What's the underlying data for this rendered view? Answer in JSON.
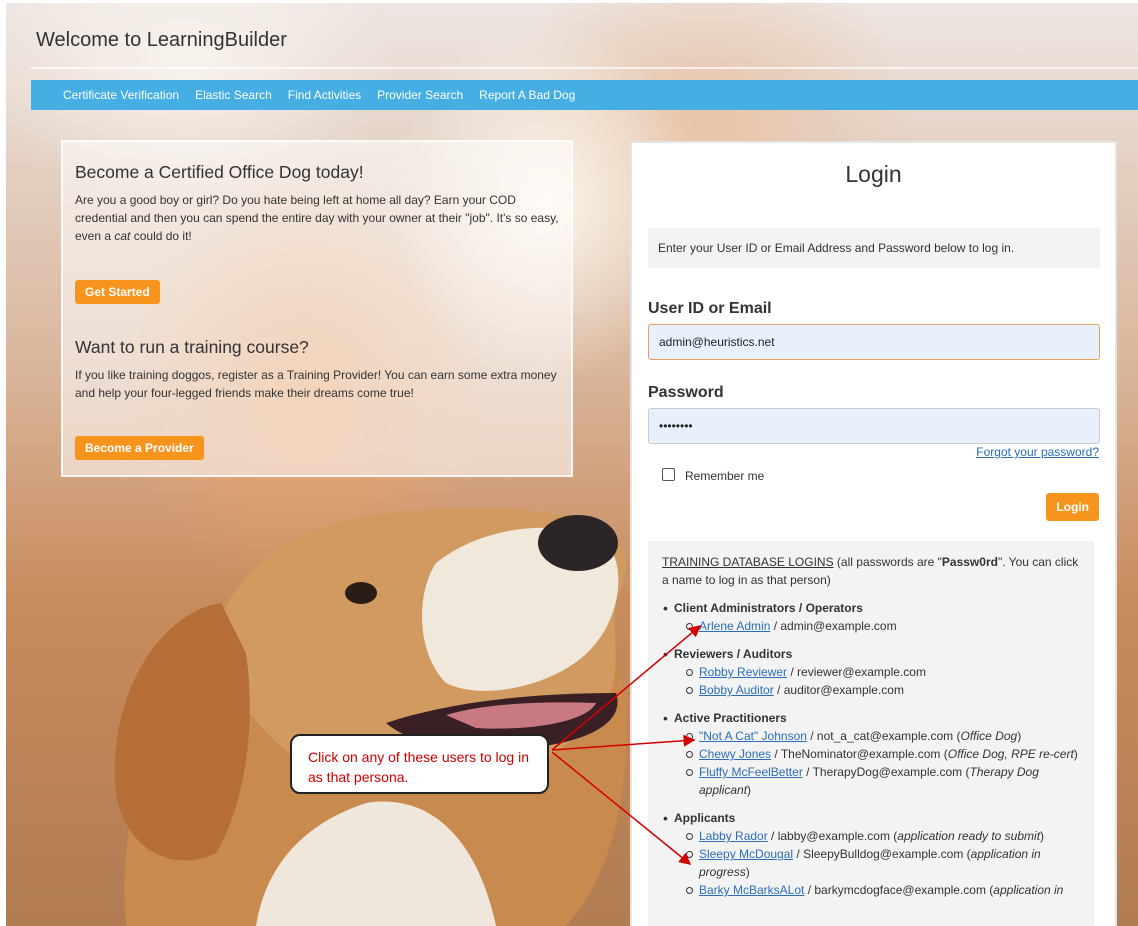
{
  "header": {
    "title": "Welcome to LearningBuilder"
  },
  "nav": {
    "items": [
      "Certificate Verification",
      "Elastic Search",
      "Find Activities",
      "Provider Search",
      "Report A Bad Dog"
    ]
  },
  "promo": {
    "heading1": "Become a Certified Office Dog today!",
    "text1_a": "Are you a good boy or girl? Do you hate being left at home all day? Earn your COD credential and then you can spend the entire day with your owner at their \"job\". It's so easy, even a ",
    "text1_em": "cat",
    "text1_b": " could do it!",
    "button1": "Get Started",
    "heading2": "Want to run a training course?",
    "text2": "If you like training doggos, register as a Training Provider! You can earn some extra money and help your four-legged friends make their dreams come true!",
    "button2": "Become a Provider"
  },
  "login": {
    "title": "Login",
    "info": "Enter your User ID or Email Address and Password below to log in.",
    "user_label": "User ID or Email",
    "user_value": "admin@heuristics.net",
    "password_label": "Password",
    "password_value": "••••••••",
    "forgot": "Forgot your password?",
    "remember": "Remember me",
    "button": "Login"
  },
  "training": {
    "heading_link": "TRAINING DATABASE LOGINS",
    "heading_a": " (all passwords are \"",
    "heading_pw": "Passw0rd",
    "heading_b": "\". You can click a name to log in as that person)",
    "groups": [
      {
        "title": "Client Administrators / Operators",
        "users": [
          {
            "name": "Arlene Admin",
            "email": " / admin@example.com",
            "note": ""
          }
        ]
      },
      {
        "title": "Reviewers / Auditors",
        "users": [
          {
            "name": "Robby Reviewer",
            "email": " / reviewer@example.com",
            "note": ""
          },
          {
            "name": "Bobby Auditor",
            "email": " / auditor@example.com",
            "note": ""
          }
        ]
      },
      {
        "title": "Active Practitioners",
        "users": [
          {
            "name": "\"Not A Cat\" Johnson",
            "email": " / not_a_cat@example.com (",
            "note": "Office Dog",
            "close": ")"
          },
          {
            "name": "Chewy Jones",
            "email": " / TheNominator@example.com (",
            "note": "Office Dog, RPE re-cert",
            "close": ")"
          },
          {
            "name": "Fluffy McFeelBetter",
            "email": " / TherapyDog@example.com (",
            "note": "Therapy Dog applicant",
            "close": ")"
          }
        ]
      },
      {
        "title": "Applicants",
        "users": [
          {
            "name": "Labby Rador",
            "email": " / labby@example.com (",
            "note": "application ready to submit",
            "close": ")"
          },
          {
            "name": "Sleepy McDougal",
            "email": " / SleepyBulldog@example.com (",
            "note": "application in progress",
            "close": ")"
          },
          {
            "name": "Barky McBarksALot",
            "email": " / barkymcdogface@example.com (",
            "note": "application in",
            "close": ""
          }
        ]
      }
    ]
  },
  "callout": {
    "text": "Click on any of these users to log in as that persona."
  },
  "colors": {
    "nav": "#45aee3",
    "accent": "#f7941d",
    "link": "#2a6ebb",
    "callout_text": "#cc0000"
  }
}
